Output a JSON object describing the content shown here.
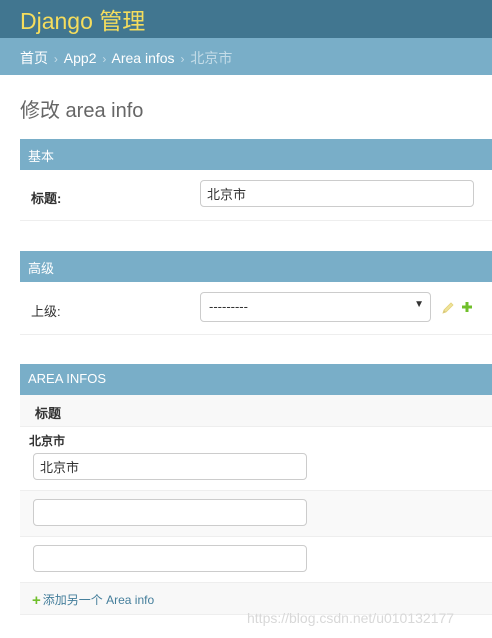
{
  "header": {
    "brand": "Django 管理"
  },
  "breadcrumbs": {
    "home": "首页",
    "app": "App2",
    "model": "Area infos",
    "current": "北京市",
    "separator": "›"
  },
  "page": {
    "title": "修改 area info"
  },
  "fieldsets": {
    "basic": {
      "title": "基本",
      "field_label": "标题:",
      "field_value": "北京市"
    },
    "advanced": {
      "title": "高级",
      "field_label": "上级:",
      "select_value": "---------",
      "select_arrow": "▼",
      "edit_icon": "pencil-icon",
      "add_icon": "plus-icon"
    }
  },
  "inline": {
    "title": "AREA INFOS",
    "column_header": "标题",
    "rows": [
      {
        "original": "北京市",
        "value": "北京市"
      },
      {
        "original": "",
        "value": ""
      },
      {
        "original": "",
        "value": ""
      }
    ],
    "add_icon": "plus-icon",
    "add_label": "添加另一个 Area info"
  },
  "watermark": "https://blog.csdn.net/u010132177",
  "colors": {
    "header_bg": "#417690",
    "brand": "#f5dd5d",
    "breadcrumb_bg": "#79aec8",
    "module_header_bg": "#79aec8",
    "link": "#447e9b",
    "add_green": "#70bf2b",
    "edit_yellow": "#efb80b"
  }
}
